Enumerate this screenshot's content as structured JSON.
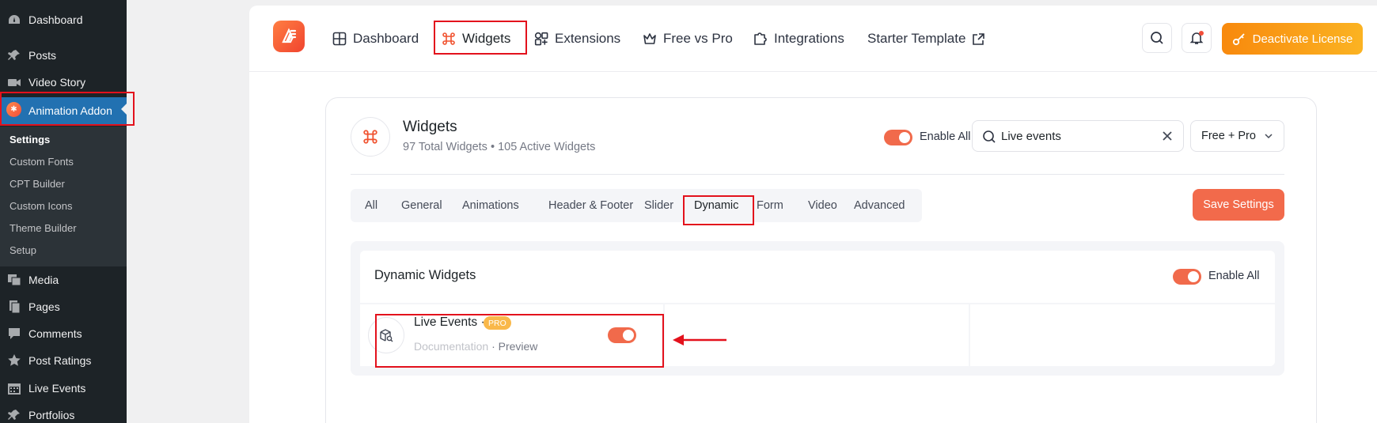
{
  "wp_sidebar": {
    "items": [
      {
        "label": "Dashboard",
        "icon": "dashboard-icon"
      },
      {
        "label": "Posts",
        "icon": "pin-icon"
      },
      {
        "label": "Video Story",
        "icon": "video-icon"
      },
      {
        "label": "Animation Addon",
        "icon": "animation-addon-logo-icon"
      },
      {
        "label": "Media",
        "icon": "media-icon"
      },
      {
        "label": "Pages",
        "icon": "pages-icon"
      },
      {
        "label": "Comments",
        "icon": "comment-icon"
      },
      {
        "label": "Post Ratings",
        "icon": "star-icon"
      },
      {
        "label": "Live Events",
        "icon": "calendar-icon"
      },
      {
        "label": "Portfolios",
        "icon": "pin-icon"
      }
    ],
    "submenu": [
      "Settings",
      "Custom Fonts",
      "CPT Builder",
      "Custom Icons",
      "Theme Builder",
      "Setup"
    ]
  },
  "topnav": {
    "items": [
      "Dashboard",
      "Widgets",
      "Extensions",
      "Free vs Pro",
      "Integrations",
      "Starter Template"
    ],
    "deactivate_label": "Deactivate License"
  },
  "widgets_panel": {
    "title": "Widgets",
    "subtitle": "97 Total Widgets • 105 Active Widgets",
    "enable_all_label": "Enable All",
    "search_value": "Live events",
    "filter_value": "Free + Pro",
    "tabs": [
      "All",
      "General",
      "Animations",
      "Header & Footer",
      "Slider",
      "Dynamic",
      "Form",
      "Video",
      "Advanced"
    ],
    "save_label": "Save Settings",
    "group": {
      "title": "Dynamic Widgets",
      "enable_all_label": "Enable All",
      "widget": {
        "name": "Live Events",
        "separator": "·",
        "badge": "PRO",
        "doc_link": "Documentation",
        "preview_link": "Preview",
        "enabled": true
      }
    }
  },
  "colors": {
    "accent": "#f26a4b",
    "wp_active": "#2271b1",
    "highlight": "#e3111c",
    "license_button": "#f8890d"
  }
}
